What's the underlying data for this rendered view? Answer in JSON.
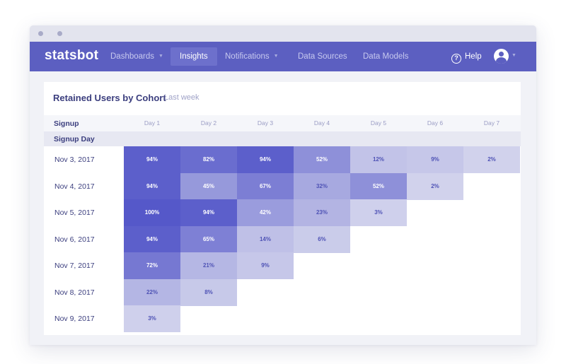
{
  "navbar": {
    "logo": "statsbot",
    "items": [
      {
        "label": "Dashboards",
        "caret": true,
        "active": false
      },
      {
        "label": "Insights",
        "caret": false,
        "active": true
      },
      {
        "label": "Notifications",
        "caret": true,
        "active": false
      },
      {
        "label": "Data Sources",
        "caret": false,
        "active": false
      },
      {
        "label": "Data Models",
        "caret": false,
        "active": false
      }
    ],
    "help_label": "Help",
    "help_icon": "question-circle-icon",
    "avatar_icon": "user-avatar-icon"
  },
  "report": {
    "title": "Retained Users by Cohort",
    "subtitle": "Last week",
    "signup_header": "Signup",
    "signup_day_header": "Signup Day",
    "days": [
      "Day 1",
      "Day 2",
      "Day 3",
      "Day 4",
      "Day 5",
      "Day 6",
      "Day 7"
    ],
    "cohorts": [
      {
        "date": "Nov 3, 2017",
        "values": [
          "94%",
          "82%",
          "94%",
          "52%",
          "12%",
          "9%",
          "2%"
        ]
      },
      {
        "date": "Nov 4, 2017",
        "values": [
          "94%",
          "45%",
          "67%",
          "32%",
          "52%",
          "2%"
        ]
      },
      {
        "date": "Nov 5, 2017",
        "values": [
          "100%",
          "94%",
          "42%",
          "23%",
          "3%"
        ]
      },
      {
        "date": "Nov 6, 2017",
        "values": [
          "94%",
          "65%",
          "14%",
          "6%"
        ]
      },
      {
        "date": "Nov 7, 2017",
        "values": [
          "72%",
          "21%",
          "9%"
        ]
      },
      {
        "date": "Nov 8, 2017",
        "values": [
          "22%",
          "8%"
        ]
      },
      {
        "date": "Nov 9, 2017",
        "values": [
          "3%"
        ]
      }
    ]
  },
  "colors": {
    "accent": "#5c5fc1",
    "cell_high": "#5558c9",
    "cell_low": "#e6e7f2",
    "text_dark": "#3b3e7e"
  }
}
